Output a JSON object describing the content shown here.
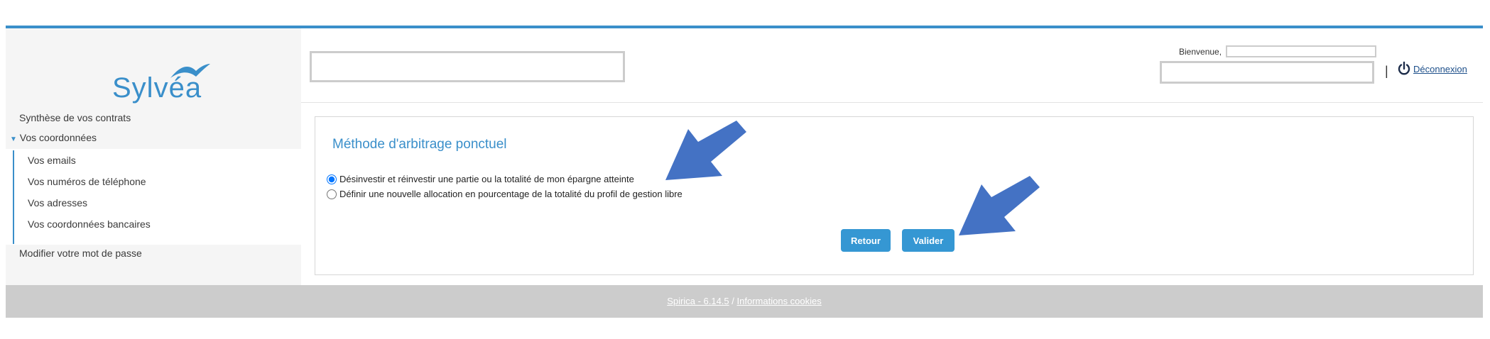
{
  "brand": {
    "name": "Sylvéa",
    "color": "#3a8fca"
  },
  "sidebar": {
    "items": [
      {
        "label": "Synthèse de vos contrats"
      },
      {
        "label": "Vos coordonnées",
        "expanded": true,
        "children": [
          {
            "label": "Vos emails"
          },
          {
            "label": "Vos numéros de téléphone"
          },
          {
            "label": "Vos adresses"
          },
          {
            "label": "Vos coordonnées bancaires"
          }
        ]
      },
      {
        "label": "Modifier votre mot de passe"
      }
    ]
  },
  "header": {
    "welcome_label": "Bienvenue,",
    "separator": "|",
    "logout_label": "Déconnexion",
    "logout_icon": "power-icon"
  },
  "main": {
    "title": "Méthode d'arbitrage ponctuel",
    "options": [
      {
        "label": "Désinvestir et réinvestir une partie ou la totalité de mon épargne atteinte",
        "checked": true
      },
      {
        "label": "Définir une nouvelle allocation en pourcentage de la totalité du profil de gestion libre",
        "checked": false
      }
    ],
    "buttons": {
      "back_label": "Retour",
      "submit_label": "Valider"
    },
    "button_color": "#3597d3"
  },
  "footer": {
    "version_link": "Spirica - 6.14.5",
    "separator": "/",
    "cookies_link": "Informations cookies"
  },
  "annotation_color": "#4472c4"
}
